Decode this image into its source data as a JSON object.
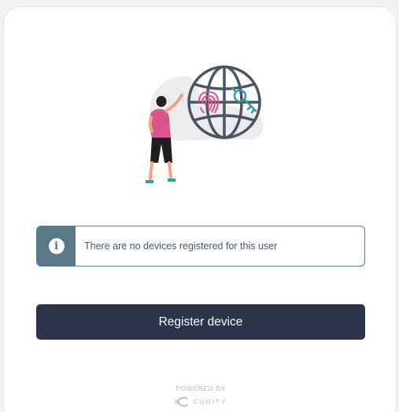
{
  "illustration": {
    "accent_pink": "#e0528f",
    "accent_teal": "#2aa198",
    "globe_stroke": "#4a5465",
    "icons": [
      "fingerprint-icon",
      "key-icon",
      "globe-icon"
    ]
  },
  "alert": {
    "icon": "info-icon",
    "message": "There are no devices registered for this user",
    "border_color": "#5c7c8a",
    "icon_bg": "#5a7885"
  },
  "actions": {
    "register_label": "Register device",
    "button_color": "#2b3448"
  },
  "footer": {
    "powered_by": "POWERED BY",
    "brand_name": "CURITY",
    "logo_icon": "curity-logo-icon"
  }
}
